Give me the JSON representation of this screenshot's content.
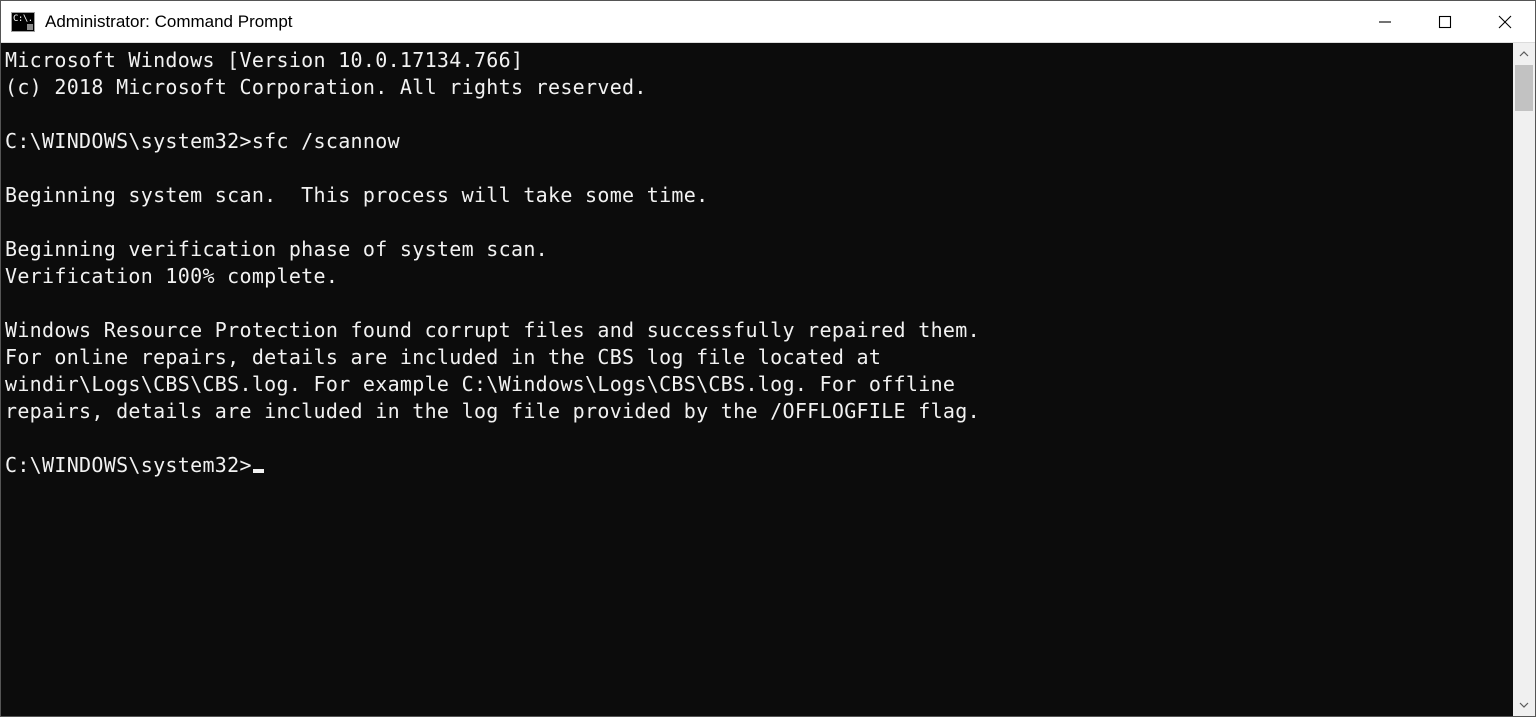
{
  "window": {
    "title": "Administrator: Command Prompt",
    "icon_label": "C:\\."
  },
  "console": {
    "lines": [
      "Microsoft Windows [Version 10.0.17134.766]",
      "(c) 2018 Microsoft Corporation. All rights reserved.",
      "",
      "C:\\WINDOWS\\system32>sfc /scannow",
      "",
      "Beginning system scan.  This process will take some time.",
      "",
      "Beginning verification phase of system scan.",
      "Verification 100% complete.",
      "",
      "Windows Resource Protection found corrupt files and successfully repaired them.",
      "For online repairs, details are included in the CBS log file located at",
      "windir\\Logs\\CBS\\CBS.log. For example C:\\Windows\\Logs\\CBS\\CBS.log. For offline",
      "repairs, details are included in the log file provided by the /OFFLOGFILE flag.",
      ""
    ],
    "prompt": "C:\\WINDOWS\\system32>"
  }
}
